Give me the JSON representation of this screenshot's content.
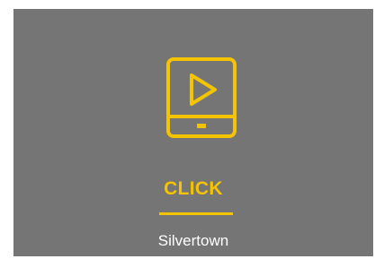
{
  "tile": {
    "icon": "play-tablet-icon",
    "title": "CLICK",
    "location": "Silvertown"
  },
  "colors": {
    "background": "#757575",
    "accent": "#f5c400",
    "text": "#ffffff"
  }
}
